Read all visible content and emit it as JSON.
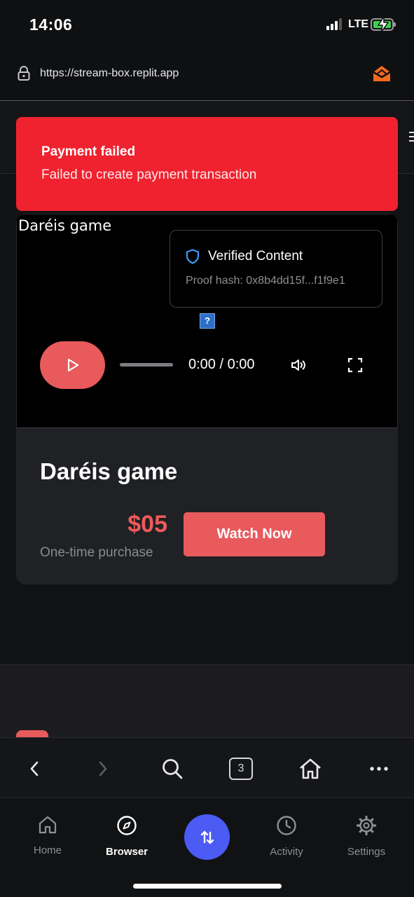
{
  "status_bar": {
    "time": "14:06",
    "network": "LTE",
    "battery_color": "#3cd14f"
  },
  "browser": {
    "url": "https://stream-box.replit.app"
  },
  "toast": {
    "title": "Payment failed",
    "message": "Failed to create payment transaction",
    "color": "#f0222f"
  },
  "video": {
    "title": "Daréis game",
    "verified_label": "Verified Content",
    "proof_hash": "Proof hash: 0x8b4dd15f...f1f9e1",
    "broken_image_glyph": "?",
    "timecode": "0:00 / 0:00"
  },
  "content": {
    "title": "Daréis game",
    "price": "$05",
    "price_note": "One-time purchase",
    "watch_label": "Watch Now",
    "accent": "#e85a5c"
  },
  "browser_bar": {
    "tab_count": "3"
  },
  "tab_bar": {
    "items": [
      {
        "label": "Home",
        "icon": "home-icon"
      },
      {
        "label": "Browser",
        "icon": "compass-icon"
      },
      {
        "label": "Activity",
        "icon": "clock-icon"
      },
      {
        "label": "Settings",
        "icon": "gear-icon"
      }
    ],
    "fab_icon": "swap-arrows-icon",
    "fab_color": "#4b5bf3"
  }
}
